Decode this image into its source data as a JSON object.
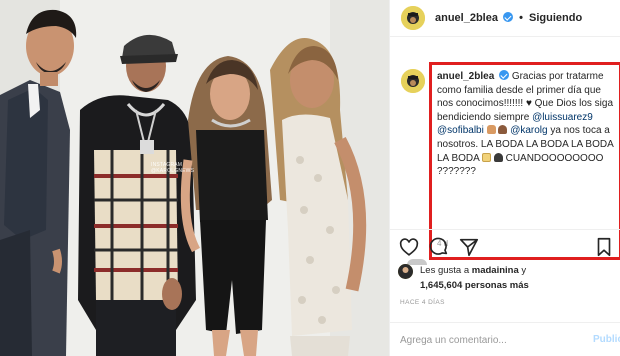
{
  "post": {
    "username": "anuel_2blea",
    "separator": "•",
    "follow_state": "Siguiendo"
  },
  "photo": {
    "watermark": "INSTAGRAM @KAROLGNEWS"
  },
  "comment": {
    "username": "anuel_2blea",
    "text_1": "Gracias por tratarme como familia desde el primer día que nos conocimos!!!!!!!",
    "heart": "♥",
    "text_2": "Que Dios los siga bendiciendo siempre",
    "mention_1": "@luissuarez9",
    "mention_2": "@sofibalbi",
    "mention_3": "@karolg",
    "text_3": "ya nos toca a nosotros. LA BODA LA BODA LA BODA LA BODA",
    "text_4": "CUANDOOOOOOOO ???????",
    "time": "4 d"
  },
  "likes": {
    "prefix": "Les gusta a",
    "user": "madainina",
    "connector": "y",
    "count": "1,645,604",
    "suffix": "personas más"
  },
  "ago": "HACE 4 DÍAS",
  "add_comment": {
    "placeholder": "Agrega un comentario...",
    "publish_label": "Publicar"
  },
  "icons": [
    "verified-badge-icon",
    "heart-icon",
    "comment-icon",
    "share-icon",
    "bookmark-icon"
  ],
  "colors": {
    "highlight_box": "#e01f1f",
    "verified": "#3897f0",
    "mention": "#003569",
    "publish_disabled": "#b3dbff"
  }
}
